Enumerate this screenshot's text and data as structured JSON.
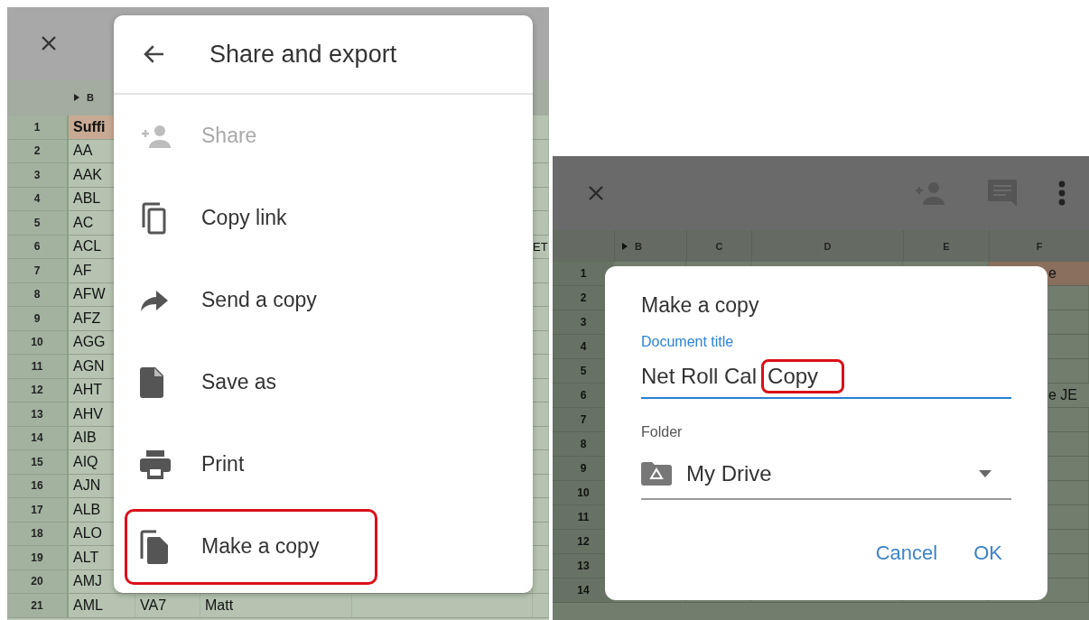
{
  "share_screen": {
    "sheet": {
      "column_headers": [
        "B"
      ],
      "rows": [
        {
          "number": "1",
          "header": true,
          "cells": [
            "Suffi"
          ]
        },
        {
          "number": "2",
          "header": false,
          "cells": [
            "AA"
          ]
        },
        {
          "number": "3",
          "header": false,
          "cells": [
            "AAK"
          ]
        },
        {
          "number": "4",
          "header": false,
          "cells": [
            "ABL"
          ]
        },
        {
          "number": "5",
          "header": false,
          "cells": [
            "AC"
          ]
        },
        {
          "number": "6",
          "header": false,
          "cells": [
            "ACL"
          ],
          "edge_text": "ET"
        },
        {
          "number": "7",
          "header": false,
          "cells": [
            "AF"
          ]
        },
        {
          "number": "8",
          "header": false,
          "cells": [
            "AFW"
          ]
        },
        {
          "number": "9",
          "header": false,
          "cells": [
            "AFZ"
          ]
        },
        {
          "number": "10",
          "header": false,
          "cells": [
            "AGG"
          ]
        },
        {
          "number": "11",
          "header": false,
          "cells": [
            "AGN"
          ]
        },
        {
          "number": "12",
          "header": false,
          "cells": [
            "AHT"
          ]
        },
        {
          "number": "13",
          "header": false,
          "cells": [
            "AHV"
          ]
        },
        {
          "number": "14",
          "header": false,
          "cells": [
            "AIB"
          ]
        },
        {
          "number": "15",
          "header": false,
          "cells": [
            "AIQ"
          ]
        },
        {
          "number": "16",
          "header": false,
          "cells": [
            "AJN"
          ]
        },
        {
          "number": "17",
          "header": false,
          "cells": [
            "ALB"
          ]
        },
        {
          "number": "18",
          "header": false,
          "cells": [
            "ALO"
          ]
        },
        {
          "number": "19",
          "header": false,
          "cells": [
            "ALT"
          ]
        },
        {
          "number": "20",
          "header": false,
          "cells": [
            "AMJ"
          ]
        },
        {
          "number": "21",
          "header": false,
          "cells": [
            "AML",
            "VA7",
            "Matt"
          ]
        }
      ]
    },
    "menu": {
      "title": "Share and export",
      "items": [
        {
          "kind": "share",
          "label": "Share",
          "disabled": true,
          "highlighted": false
        },
        {
          "kind": "link",
          "label": "Copy link",
          "disabled": false,
          "highlighted": false
        },
        {
          "kind": "send",
          "label": "Send a copy",
          "disabled": false,
          "highlighted": false
        },
        {
          "kind": "save",
          "label": "Save as",
          "disabled": false,
          "highlighted": false
        },
        {
          "kind": "print",
          "label": "Print",
          "disabled": false,
          "highlighted": false
        },
        {
          "kind": "copy",
          "label": "Make a copy",
          "disabled": false,
          "highlighted": true
        }
      ]
    }
  },
  "copy_screen": {
    "sheet": {
      "column_headers": [
        "B",
        "C",
        "D",
        "E",
        "F"
      ],
      "rows": [
        {
          "number": "1",
          "header": true,
          "edge_text": "e"
        },
        {
          "number": "2",
          "header": false
        },
        {
          "number": "3",
          "header": false
        },
        {
          "number": "4",
          "header": false
        },
        {
          "number": "5",
          "header": false
        },
        {
          "number": "6",
          "header": false,
          "edge_text": "e JE"
        },
        {
          "number": "7",
          "header": false
        },
        {
          "number": "8",
          "header": false
        },
        {
          "number": "9",
          "header": false
        },
        {
          "number": "10",
          "header": false
        },
        {
          "number": "11",
          "header": false
        },
        {
          "number": "12",
          "header": false
        },
        {
          "number": "13",
          "header": false
        },
        {
          "number": "14",
          "header": false
        }
      ]
    },
    "dialog": {
      "title": "Make a copy",
      "title_field": {
        "label": "Document title",
        "value_parts": [
          {
            "text": "Net Roll Cal",
            "highlighted": false
          },
          {
            "text": "Copy",
            "highlighted": true
          }
        ]
      },
      "folder_field": {
        "label": "Folder",
        "value": "My Drive"
      },
      "buttons": [
        "Cancel",
        "OK"
      ]
    }
  }
}
